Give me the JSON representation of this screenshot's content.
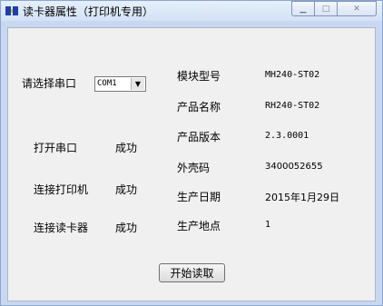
{
  "window": {
    "title": "读卡器属性（打印机专用）"
  },
  "port": {
    "label": "请选择串口",
    "selected": "COM1"
  },
  "status": [
    {
      "label": "打开串口",
      "value": "成功"
    },
    {
      "label": "连接打印机",
      "value": "成功"
    },
    {
      "label": "连接读卡器",
      "value": "成功"
    }
  ],
  "info": [
    {
      "label": "模块型号",
      "value": "MH240-ST02"
    },
    {
      "label": "产品名称",
      "value": "RH240-ST02"
    },
    {
      "label": "产品版本",
      "value": "2.3.0001"
    },
    {
      "label": "外壳码",
      "value": "3400052655"
    },
    {
      "label": "生产日期",
      "value": "2015年1月29日"
    },
    {
      "label": "生产地点",
      "value": "1"
    }
  ],
  "actions": {
    "read_label": "开始读取"
  },
  "icons": {
    "app": "card-reader-icon",
    "min": "minimize-icon",
    "max": "maximize-icon",
    "close": "close-icon",
    "dropdown": "chevron-down-icon"
  }
}
